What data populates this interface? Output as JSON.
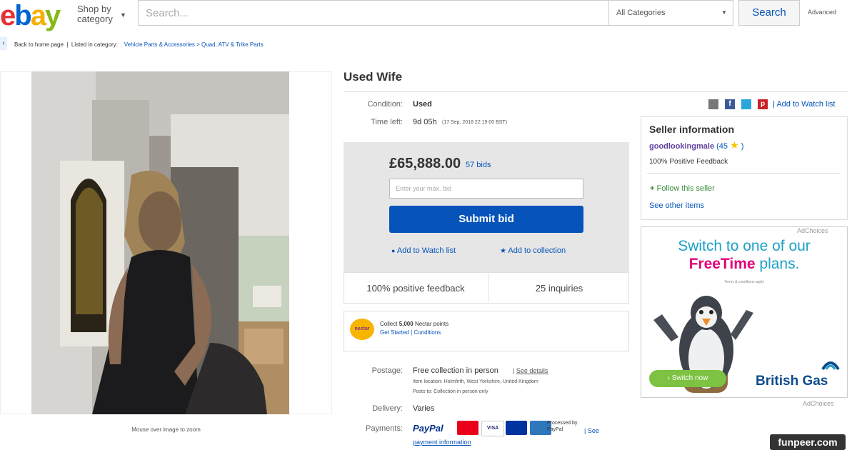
{
  "header": {
    "logo_letters": [
      "e",
      "b",
      "a",
      "y"
    ],
    "shop_by_line1": "Shop by",
    "shop_by_line2": "category",
    "search_placeholder": "Search...",
    "category_value": "All Categories",
    "search_button": "Search",
    "advanced_link": "Advanced"
  },
  "breadcrumb": {
    "back": "Back to home page",
    "listed_in": "Listed in category:",
    "cat1": "Vehicle Parts & Accessories",
    "sep": ">",
    "cat2": "Quad, ATV & Trike Parts"
  },
  "gallery": {
    "zoom_hint": "Mouse over image to zoom"
  },
  "listing": {
    "title": "Used Wife",
    "condition_label": "Condition:",
    "condition_value": "Used",
    "time_left_label": "Time left:",
    "time_left_value": "9d 05h",
    "time_left_date": "(17 Sep, 2018  22:19:00 BST)",
    "share_link": "Add to Watch list"
  },
  "bid": {
    "price": "£65,888.00",
    "bids": "57 bids",
    "max_bid_placeholder": "Enter your max. bid",
    "submit": "Submit bid",
    "watch": "Add to Watch list",
    "collection": "Add to collection",
    "feedback": "100% positive feedback",
    "inquiries": "25 inquiries"
  },
  "nectar": {
    "logo": "nectar",
    "collect_prefix": "Collect",
    "points": "5,000",
    "collect_suffix": "Nectar points",
    "get_started": "Get Started",
    "sep": "|",
    "conditions": "Conditions"
  },
  "shipping": {
    "postage_label": "Postage:",
    "postage_value": "Free collection in person",
    "see_details": "See details",
    "item_location": "Item location:  Holmfirth, West Yorkshire, United Kingdom",
    "posts_to": "Posts to:  Collection in person only",
    "delivery_label": "Delivery:",
    "delivery_value": "Varies",
    "payments_label": "Payments:",
    "paypal": "PayPal",
    "processed": "Processed by PayPal",
    "see": "See",
    "payment_info": "payment information"
  },
  "seller": {
    "heading": "Seller information",
    "name": "goodlookingmale",
    "score": "(45",
    "score_close": ")",
    "positive": "100% Positive Feedback",
    "follow": "Follow this seller",
    "other_items": "See other items"
  },
  "ad": {
    "adchoices_top": "AdChoices",
    "line1": "Switch to one of our",
    "line2_highlight": "FreeTime",
    "line2_rest": " plans.",
    "fine_print": "Terms & conditions apply",
    "button": "› Switch now",
    "brand": "British Gas",
    "adchoices_bottom": "AdChoices"
  },
  "watermark": "funpeer.com",
  "colors": {
    "ebay_red": "#e53238",
    "ebay_blue": "#0064d2",
    "ebay_yellow": "#f5af02",
    "ebay_green": "#86b817",
    "link_blue": "#0654ba",
    "ad_cyan": "#1ea0c8",
    "ad_pink": "#e4007c"
  }
}
